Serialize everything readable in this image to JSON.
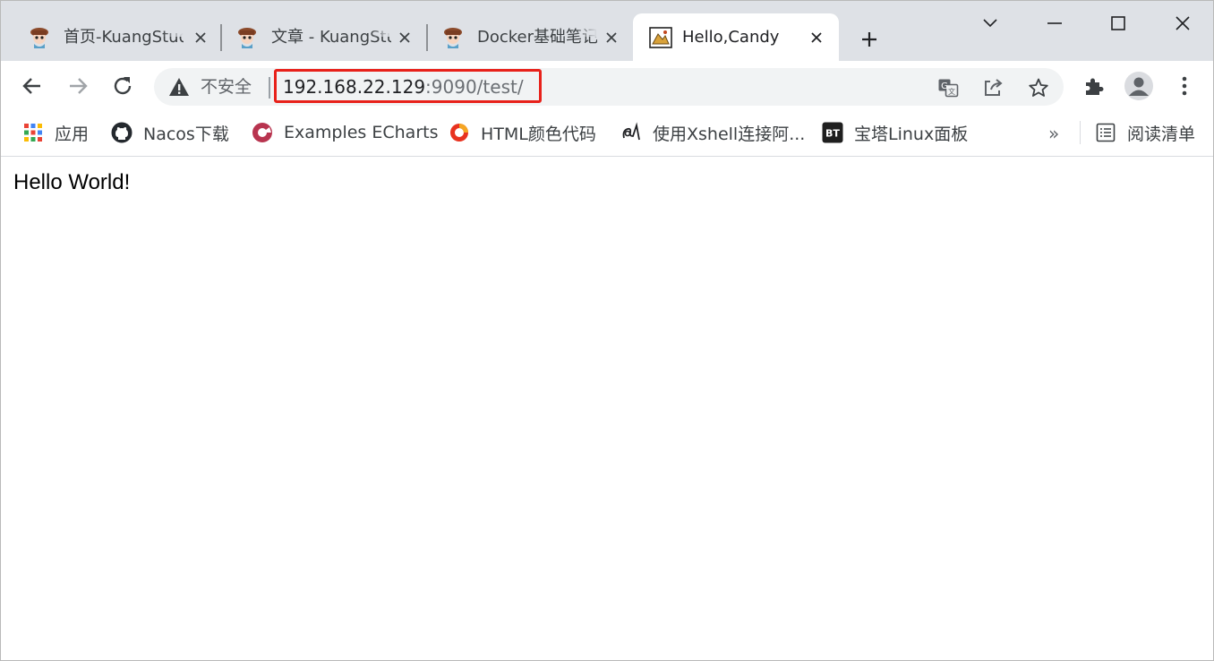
{
  "tabs": [
    {
      "title": "首页-KuangStudy",
      "icon": "anime-avatar-icon",
      "active": false
    },
    {
      "title": "文章 - KuangStudy",
      "icon": "anime-avatar-icon",
      "active": false
    },
    {
      "title": "Docker基础笔记",
      "icon": "anime-avatar-icon",
      "active": false
    },
    {
      "title": "Hello,Candy",
      "icon": "candy-image-icon",
      "active": true
    }
  ],
  "toolbar": {
    "security_label": "不安全",
    "url_host": "192.168.22.129",
    "url_rest": ":9090/test/"
  },
  "bookmarks": [
    {
      "label": "应用",
      "icon": "apps-grid-icon"
    },
    {
      "label": "Nacos下载",
      "icon": "github-icon"
    },
    {
      "label": "Examples ECharts",
      "icon": "echarts-icon"
    },
    {
      "label": "HTML颜色代码",
      "icon": "color-wheel-icon"
    },
    {
      "label": "使用Xshell连接阿...",
      "icon": "xshell-icon"
    },
    {
      "label": "宝塔Linux面板",
      "icon": "bt-panel-icon"
    }
  ],
  "bookmarks_more": "»",
  "reading_list": {
    "label": "阅读清单",
    "icon": "reading-list-icon"
  },
  "page": {
    "body_text": "Hello World!"
  },
  "colors": {
    "tabstrip": "#dee1e6",
    "omnibox": "#f1f3f4",
    "highlight_box": "#e8211a"
  }
}
